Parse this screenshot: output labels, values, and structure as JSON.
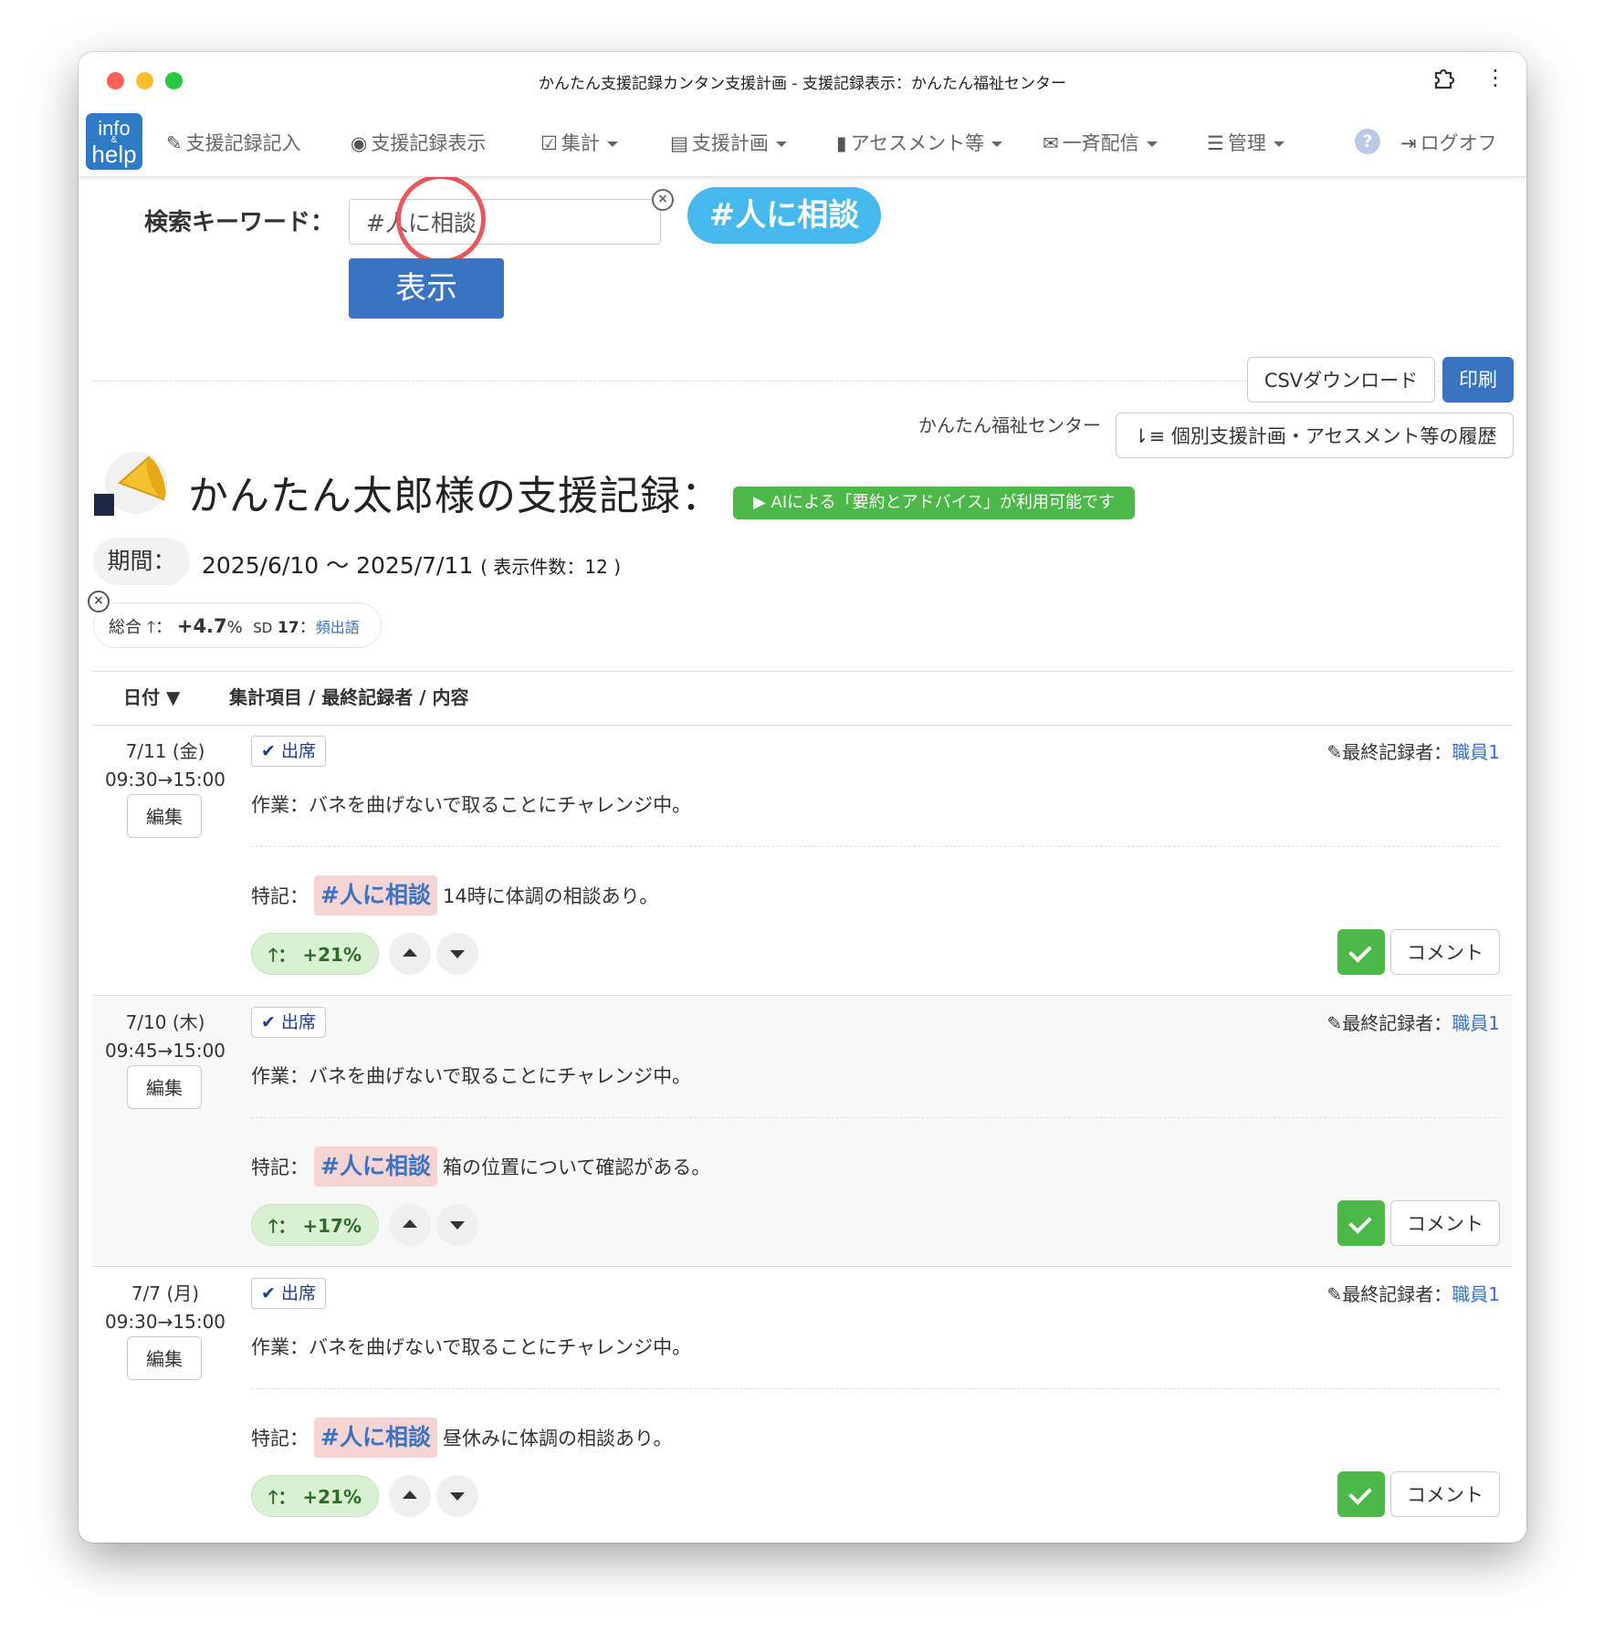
{
  "window": {
    "title": "かんたん支援記録カンタン支援計画 - 支援記録表示：かんたん福祉センター"
  },
  "logo": {
    "line1": "info",
    "amp": "&",
    "line2": "help"
  },
  "nav": {
    "items": [
      {
        "label": "支援記録記入"
      },
      {
        "label": "支援記録表示"
      },
      {
        "label": "集計"
      },
      {
        "label": "支援計画"
      },
      {
        "label": "アセスメント等"
      },
      {
        "label": "一斉配信"
      },
      {
        "label": "管理"
      }
    ],
    "help": "?",
    "logout": "ログオフ"
  },
  "search": {
    "label": "検索キーワード：",
    "value": "#人に相談",
    "tag": "#人に相談",
    "show_button": "表示"
  },
  "toolbar": {
    "csv": "CSVダウンロード",
    "print": "印刷",
    "center": "かんたん福祉センター",
    "history": "個別支援計画・アセスメント等の履歴"
  },
  "page": {
    "title": "かんたん太郎様の支援記録：",
    "ai_badge": "▶ AIによる「要約とアドバイス」が利用可能です",
    "period_label": "期間：",
    "period_value": "2025/6/10 〜 2025/7/11",
    "period_count": "( 表示件数：12 )"
  },
  "summary": {
    "label": "総合",
    "value": "+4.7",
    "unit": "%",
    "sd_label": "SD",
    "sd_value": "17",
    "link": "頻出語"
  },
  "table": {
    "col_date": "日付 ▼",
    "col_content": "集計項目 / 最終記録者 / 内容"
  },
  "records": [
    {
      "date": "7/11 (金)",
      "time": "09:30→15:00",
      "edit": "編集",
      "attendance": "出席",
      "recorder_label": "最終記録者：",
      "recorder": "職員1",
      "work": "作業：バネを曲げないで取ることにチャレンジ中。",
      "note_label": "特記：",
      "note_tag": "#人に相談",
      "note_text": "14時に体調の相談あり。",
      "score_value": "+21",
      "score_unit": "%",
      "comment": "コメント"
    },
    {
      "date": "7/10 (木)",
      "time": "09:45→15:00",
      "edit": "編集",
      "attendance": "出席",
      "recorder_label": "最終記録者：",
      "recorder": "職員1",
      "work": "作業：バネを曲げないで取ることにチャレンジ中。",
      "note_label": "特記：",
      "note_tag": "#人に相談",
      "note_text": "箱の位置について確認がある。",
      "score_value": "+17",
      "score_unit": "%",
      "comment": "コメント"
    },
    {
      "date": "7/7 (月)",
      "time": "09:30→15:00",
      "edit": "編集",
      "attendance": "出席",
      "recorder_label": "最終記録者：",
      "recorder": "職員1",
      "work": "作業：バネを曲げないで取ることにチャレンジ中。",
      "note_label": "特記：",
      "note_tag": "#人に相談",
      "note_text": "昼休みに体調の相談あり。",
      "score_value": "+21",
      "score_unit": "%",
      "comment": "コメント"
    }
  ],
  "colors": {
    "primary": "#3a73c2",
    "success": "#4cb847",
    "tag_pill": "#46b8ec",
    "highlight": "#e8585a"
  }
}
